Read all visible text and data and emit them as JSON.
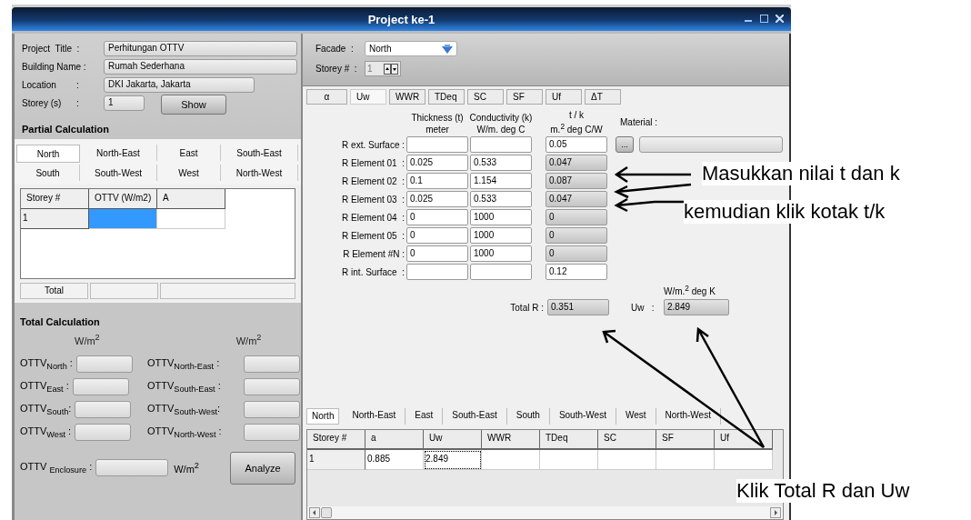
{
  "window": {
    "title": "Project ke-1"
  },
  "project": {
    "fields": [
      {
        "label": "Project  Title  :",
        "value": "Perhitungan OTTV",
        "kind": "wide"
      },
      {
        "label": "Building Name :",
        "value": "Rumah Sederhana",
        "kind": "wide"
      },
      {
        "label": "Location        :",
        "value": "DKI Jakarta, Jakarta",
        "kind": "medium"
      },
      {
        "label": "Storey (s)      :",
        "value": "1",
        "kind": "short"
      }
    ],
    "show_button": "Show"
  },
  "partial_calculation": {
    "title": "Partial Calculation",
    "tabs": [
      {
        "label": "North",
        "selected": true
      },
      {
        "label": "North-East",
        "selected": false
      },
      {
        "label": "East",
        "selected": false
      },
      {
        "label": "South-East",
        "selected": false
      },
      {
        "label": "South",
        "selected": false
      },
      {
        "label": "South-West",
        "selected": false
      },
      {
        "label": "West",
        "selected": false
      },
      {
        "label": "North-West",
        "selected": false
      }
    ],
    "columns": [
      "Storey #",
      "OTTV (W/m2)",
      "A"
    ],
    "rows": [
      {
        "storey": "1",
        "ottv_selected": true
      }
    ],
    "total_label": "Total"
  },
  "total_calculation": {
    "title": "Total Calculation",
    "unit_left": "W/m$^{2}$",
    "unit_right": "W/m$^{2}$",
    "items": [
      {
        "label": "OTTV$_{North}$ :"
      },
      {
        "label": "OTTV$_{North-East}$ :"
      },
      {
        "label": "OTTV$_{East}$ :"
      },
      {
        "label": "OTTV$_{South-East}$ :"
      },
      {
        "label": "OTTV$_{South}$:"
      },
      {
        "label": "OTTV$_{South-West}$:"
      },
      {
        "label": "OTTV$_{West}$ :"
      },
      {
        "label": "OTTV$_{North-West}$ :"
      }
    ],
    "enclosure_label": "OTTV $_{Enclosure}$ :",
    "enclosure_unit": "W/m$^{2}$",
    "analyze_button": "Analyze"
  },
  "facade": {
    "label": "Facade  :",
    "value": "North"
  },
  "storey": {
    "label": "Storey #  :",
    "value": "1"
  },
  "parameter_tabs": [
    {
      "label": "α",
      "selected": false
    },
    {
      "label": "Uw",
      "selected": true
    },
    {
      "label": "WWR",
      "selected": false
    },
    {
      "label": "TDeq",
      "selected": false
    },
    {
      "label": "SC",
      "selected": false
    },
    {
      "label": "SF",
      "selected": false
    },
    {
      "label": "Uf",
      "selected": false
    },
    {
      "label": "ΔT",
      "selected": false
    }
  ],
  "uw_form": {
    "headers": [
      {
        "title": "Thickness (t)",
        "unit": "meter"
      },
      {
        "title": "Conductivity (k)",
        "unit": "W/m. deg C"
      },
      {
        "title": "t / k",
        "unit": "m.$^{2}$ deg C/W"
      }
    ],
    "material_label": "Material :",
    "material_button": "...",
    "rows": [
      {
        "label": "R ext. Surface :",
        "kind": "surface",
        "tk": "0.05"
      },
      {
        "label": "R Element 01  :",
        "kind": "element",
        "t": "0.025",
        "k": "0.533",
        "tk": "0.047"
      },
      {
        "label": "R Element 02  :",
        "kind": "element",
        "t": "0.1",
        "k": "1.154",
        "tk": "0.087"
      },
      {
        "label": "R Element 03  :",
        "kind": "element",
        "t": "0.025",
        "k": "0.533",
        "tk": "0.047"
      },
      {
        "label": "R Element 04  :",
        "kind": "element",
        "t": "0",
        "k": "1000",
        "tk": "0"
      },
      {
        "label": "R Element 05  :",
        "kind": "element",
        "t": "0",
        "k": "1000",
        "tk": "0"
      },
      {
        "label": "R Element #N :",
        "kind": "element",
        "t": "0",
        "k": "1000",
        "tk": "0"
      },
      {
        "label": "R int. Surface  :",
        "kind": "surface",
        "tk": "0.12"
      }
    ],
    "total_r": {
      "label": "Total R :",
      "value": "0.351"
    },
    "uw": {
      "label": "Uw   :",
      "unit": "W/m.$^{2}$ deg K",
      "value": "2.849"
    }
  },
  "facade_tabs": [
    {
      "label": "North",
      "selected": true
    },
    {
      "label": "North-East",
      "selected": false
    },
    {
      "label": "East",
      "selected": false
    },
    {
      "label": "South-East",
      "selected": false
    },
    {
      "label": "South",
      "selected": false
    },
    {
      "label": "South-West",
      "selected": false
    },
    {
      "label": "West",
      "selected": false
    },
    {
      "label": "North-West",
      "selected": false
    }
  ],
  "results_grid": {
    "columns": [
      "Storey #",
      "a",
      "Uw",
      "WWR",
      "TDeq",
      "SC",
      "SF",
      "Uf"
    ],
    "rows": [
      {
        "cells": [
          {
            "text": "1",
            "focused": false
          },
          {
            "text": "0.885",
            "focused": false
          },
          {
            "text": "2.849",
            "focused": true
          }
        ]
      }
    ]
  },
  "annotations": [
    {
      "text": "Masukkan nilai t dan k"
    },
    {
      "text": "kemudian klik kotak t/k"
    },
    {
      "text": "Klik Total R dan Uw"
    }
  ]
}
